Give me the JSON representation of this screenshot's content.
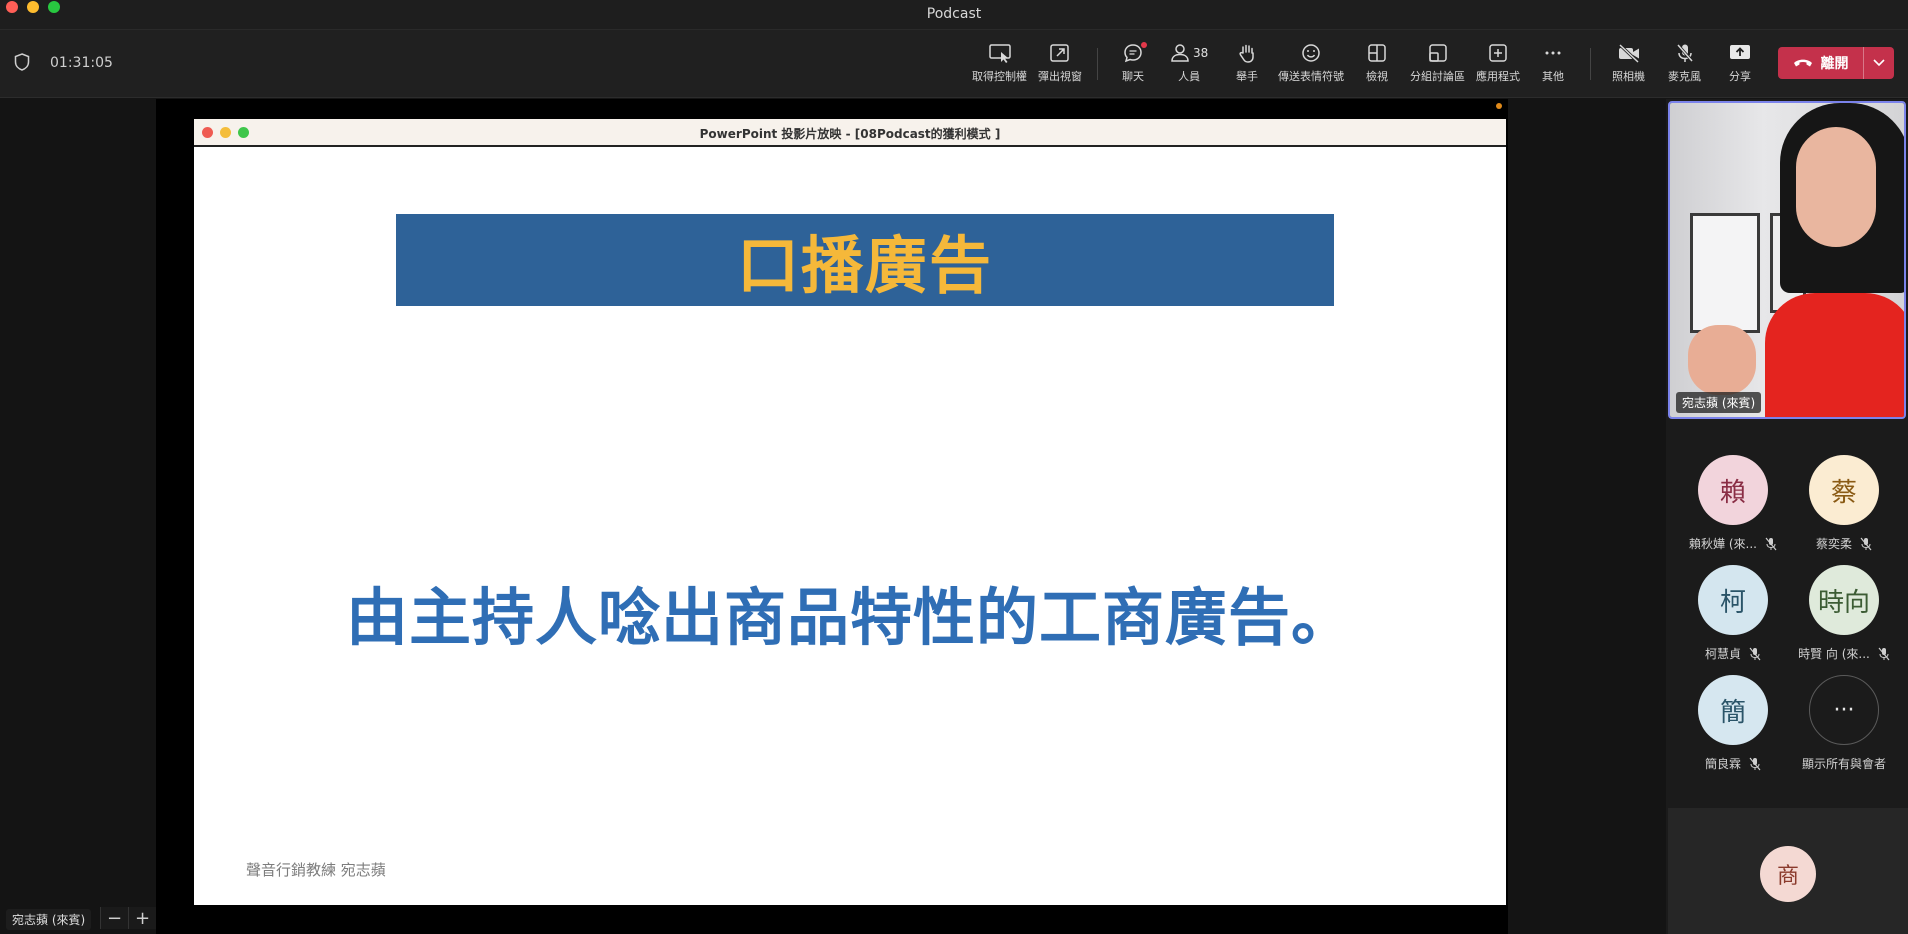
{
  "window": {
    "title": "Podcast"
  },
  "meeting": {
    "elapsed": "01:31:05"
  },
  "toolbar": {
    "take_control": "取得控制權",
    "pop_out": "彈出視窗",
    "chat": "聊天",
    "people": "人員",
    "people_count": "38",
    "raise_hand": "舉手",
    "reactions": "傳送表情符號",
    "view": "檢視",
    "breakout": "分組討論區",
    "apps": "應用程式",
    "more": "其他",
    "camera": "照相機",
    "mic": "麥克風",
    "share": "分享",
    "leave": "離開"
  },
  "presentation": {
    "window_title": "PowerPoint 投影片放映 - [08Podcast的獲利模式 ]",
    "banner": "口播廣告",
    "body": "由主持人唸出商品特性的工商廣告。",
    "footer": "聲音行銷教練 宛志蘋"
  },
  "stage": {
    "presenter_chip": "宛志蘋 (來賓)",
    "zoom_out": "−",
    "zoom_in": "+"
  },
  "video": {
    "name": "宛志蘋 (來賓)"
  },
  "participants": [
    {
      "initial": "賴",
      "name": "賴秋嬅 (來...",
      "bg": "#f2d4dc",
      "fg": "#8a2d45"
    },
    {
      "initial": "蔡",
      "name": "蔡奕柔",
      "bg": "#fbecd2",
      "fg": "#8a5a14"
    },
    {
      "initial": "柯",
      "name": "柯慧貞",
      "bg": "#d4e6ef",
      "fg": "#2a5468"
    },
    {
      "initial": "時向",
      "name": "時賢 向 (來...",
      "bg": "#dfeadb",
      "fg": "#3c5c34"
    },
    {
      "initial": "簡",
      "name": "簡良霖",
      "bg": "#d6e7f0",
      "fg": "#2a5468"
    }
  ],
  "show_all": {
    "icon": "···",
    "label": "顯示所有與會者"
  },
  "bottom_participant": {
    "initial": "商"
  }
}
